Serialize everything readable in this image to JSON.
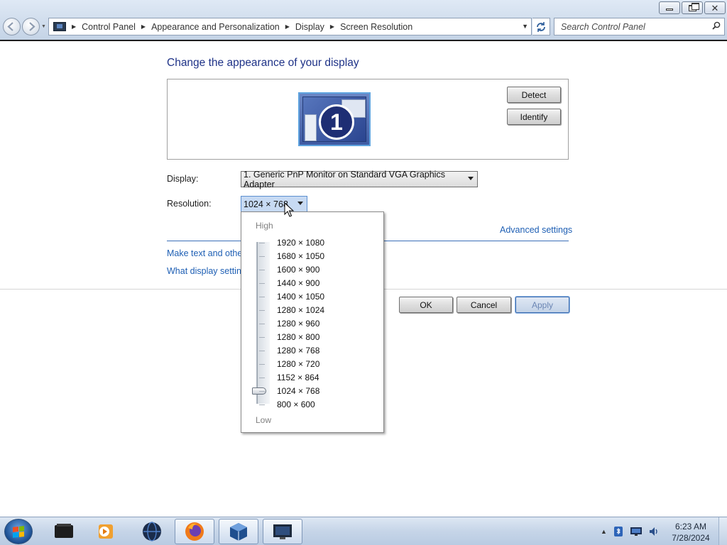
{
  "window": {
    "minimize_icon": "minimize-icon",
    "maximize_icon": "restore-icon",
    "close_icon": "close-icon"
  },
  "address_bar": {
    "breadcrumbs": [
      "Control Panel",
      "Appearance and Personalization",
      "Display",
      "Screen Resolution"
    ]
  },
  "search": {
    "placeholder": "Search Control Panel"
  },
  "main": {
    "heading": "Change the appearance of your display",
    "monitor_number": "1",
    "detect_label": "Detect",
    "identify_label": "Identify",
    "display_label": "Display:",
    "display_value": "1. Generic PnP Monitor on Standard VGA Graphics Adapter",
    "resolution_label": "Resolution:",
    "resolution_value": "1024 × 768",
    "advanced_settings": "Advanced settings",
    "link_text_size": "Make text and other",
    "link_display_settings": "What display setting",
    "ok_label": "OK",
    "cancel_label": "Cancel",
    "apply_label": "Apply"
  },
  "resolution_dropdown": {
    "high_label": "High",
    "low_label": "Low",
    "options": [
      "1920 × 1080",
      "1680 × 1050",
      "1600 × 900",
      "1440 × 900",
      "1400 × 1050",
      "1280 × 1024",
      "1280 × 960",
      "1280 × 800",
      "1280 × 768",
      "1280 × 720",
      "1152 × 864",
      "1024 × 768",
      "800 × 600"
    ],
    "selected_index": 11
  },
  "taskbar": {
    "time": "6:23 AM",
    "date": "7/28/2024"
  },
  "colors": {
    "heading": "#1e3287",
    "link": "#1e5fb4",
    "accent": "#3c6db0"
  }
}
